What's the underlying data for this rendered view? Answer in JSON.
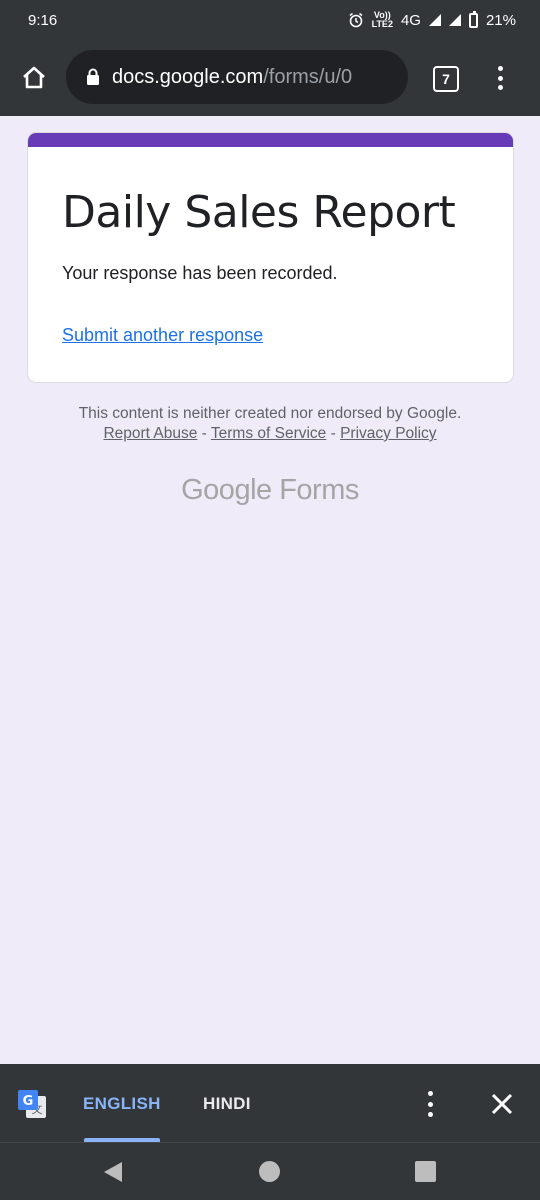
{
  "status_bar": {
    "time": "9:16",
    "network": "4G",
    "volte_top": "Vo))",
    "volte_bottom": "LTE2",
    "battery": "21%"
  },
  "browser": {
    "url_host": "docs.google.com",
    "url_path": "/forms/u/0",
    "tab_count": "7"
  },
  "form": {
    "title": "Daily Sales Report",
    "message": "Your response has been recorded.",
    "link": "Submit another response",
    "accent_color": "#673ab7"
  },
  "footer": {
    "disclaimer": "This content is neither created nor endorsed by Google.",
    "report_abuse": "Report Abuse",
    "sep1": " - ",
    "terms": "Terms of Service",
    "sep2": " - ",
    "privacy": "Privacy Policy",
    "brand_google": "Google",
    "brand_forms": " Forms"
  },
  "translate_bar": {
    "tab_active": "ENGLISH",
    "tab_other": "HINDI"
  }
}
